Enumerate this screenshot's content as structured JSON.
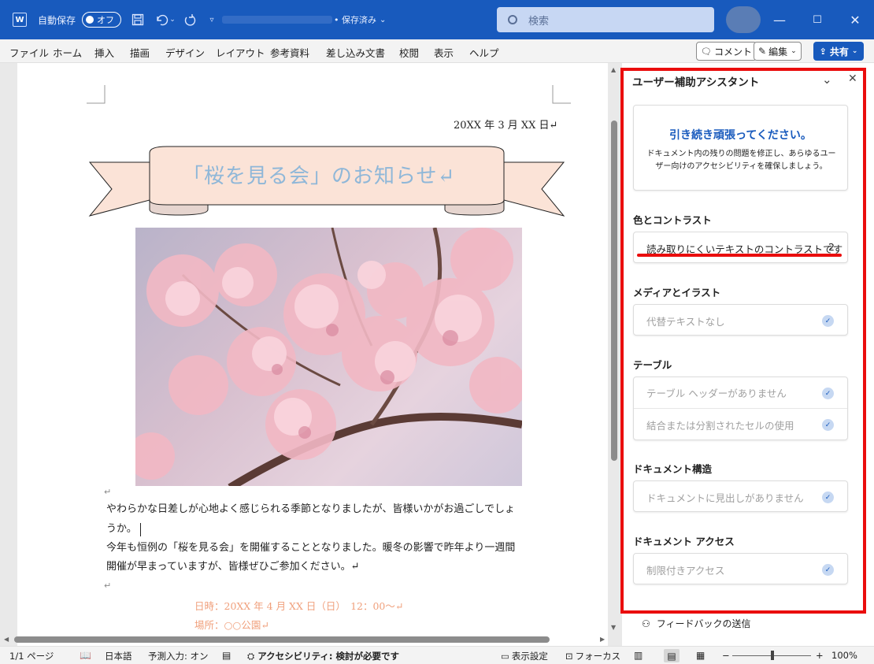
{
  "titlebar": {
    "app_icon": "W",
    "autosave_label": "自動保存",
    "autosave_toggle": "オフ",
    "saved_status": "• 保存済み",
    "search_placeholder": "検索",
    "minimize": "—",
    "restore": "☐",
    "close": "✕"
  },
  "ribbon": {
    "tabs": [
      "ファイル",
      "ホーム",
      "挿入",
      "描画",
      "デザイン",
      "レイアウト",
      "参考資料",
      "差し込み文書",
      "校閲",
      "表示",
      "ヘルプ"
    ],
    "comment_label": "コメント",
    "edit_label": "編集",
    "share_label": "共有"
  },
  "document": {
    "date": "20XX 年 3 月 XX 日↵",
    "title": "「桜を見る会」のお知らせ↵",
    "paragraph1_line1": "やわらかな日差しが心地よく感じられる季節となりましたが、皆様いかがお過ごしでしょ",
    "paragraph1_line2": "うか。",
    "paragraph2_line1": "今年も恒例の「桜を見る会」を開催することとなりました。暖冬の影響で昨年より一週間",
    "paragraph2_line2": "開催が早まっていますが、皆様ぜひご参加ください。↵",
    "event_date": "日時：20XX 年 4 月 XX 日（日）　12：00～↵",
    "event_place": "場所：○○公園↵",
    "para_mark": "↵"
  },
  "accessibility_pane": {
    "title": "ユーザー補助アシスタント",
    "hero_heading": "引き続き頑張ってください。",
    "hero_text": "ドキュメント内の残りの問題を修正し、あらゆるユーザー向けのアクセシビリティを確保しましょう。",
    "sections": [
      {
        "heading": "色とコントラスト",
        "items": [
          {
            "label": "読み取りにくいテキストのコントラストです",
            "count": "2"
          }
        ]
      },
      {
        "heading": "メディアとイラスト",
        "items": [
          {
            "label": "代替テキストなし"
          }
        ]
      },
      {
        "heading": "テーブル",
        "items": [
          {
            "label": "テーブル ヘッダーがありません"
          },
          {
            "label": "結合または分割されたセルの使用"
          }
        ]
      },
      {
        "heading": "ドキュメント構造",
        "items": [
          {
            "label": "ドキュメントに見出しがありません"
          }
        ]
      },
      {
        "heading": "ドキュメント アクセス",
        "items": [
          {
            "label": "制限付きアクセス"
          }
        ]
      }
    ],
    "feedback": "フィードバックの送信"
  },
  "statusbar": {
    "page": "1/1 ページ",
    "language": "日本語",
    "predictive": "予測入力: オン",
    "accessibility": "アクセシビリティ: 検討が必要です",
    "display_settings": "表示設定",
    "focus": "フォーカス",
    "zoom": "100%",
    "zoom_minus": "−",
    "zoom_plus": "+"
  },
  "colors": {
    "brand": "#185abd",
    "highlight": "#ea0d0d",
    "ribbon_fill": "#fbe3d7",
    "title_text": "#8fb7d8",
    "event_text": "#f0a07c"
  }
}
